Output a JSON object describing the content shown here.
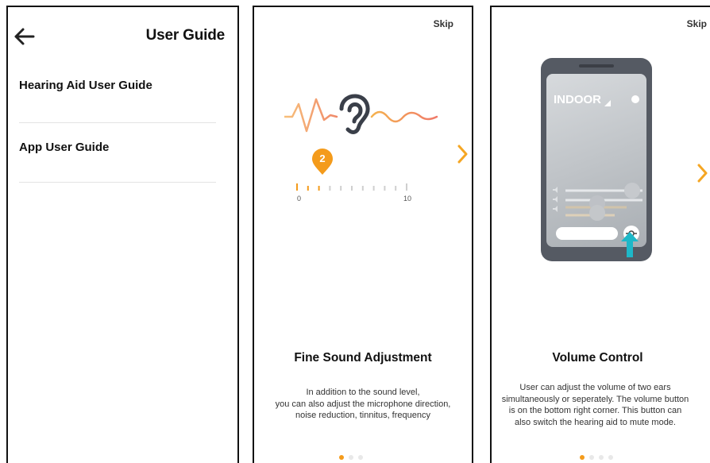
{
  "colors": {
    "accent": "#f49b1b",
    "arrow": "#f5a623",
    "teal": "#1eb8c8"
  },
  "user_guide": {
    "title": "User Guide",
    "back_icon": "arrow-left-icon",
    "items": [
      {
        "label": "Hearing Aid User Guide"
      },
      {
        "label": "App User Guide"
      }
    ]
  },
  "slide_sound": {
    "skip": "Skip",
    "title": "Fine Sound Adjustment",
    "description": "In addition to the sound level,\nyou can also adjust the microphone direction,\nnoise reduction, tinnitus, frequency",
    "level_marker": "2",
    "scale_min": "0",
    "scale_max": "10",
    "level_fraction": 0.2,
    "page_total": 3,
    "page_current": 1
  },
  "slide_volume": {
    "skip": "Skip",
    "phone_label": "INDOOR",
    "title": "Volume Control",
    "description": "User can adjust the volume of two ears\nsimultaneously or seperately. The volume button\nis on the bottom right corner. This button can\nalso switch the hearing aid to mute mode.",
    "page_total": 4,
    "page_current": 1
  }
}
